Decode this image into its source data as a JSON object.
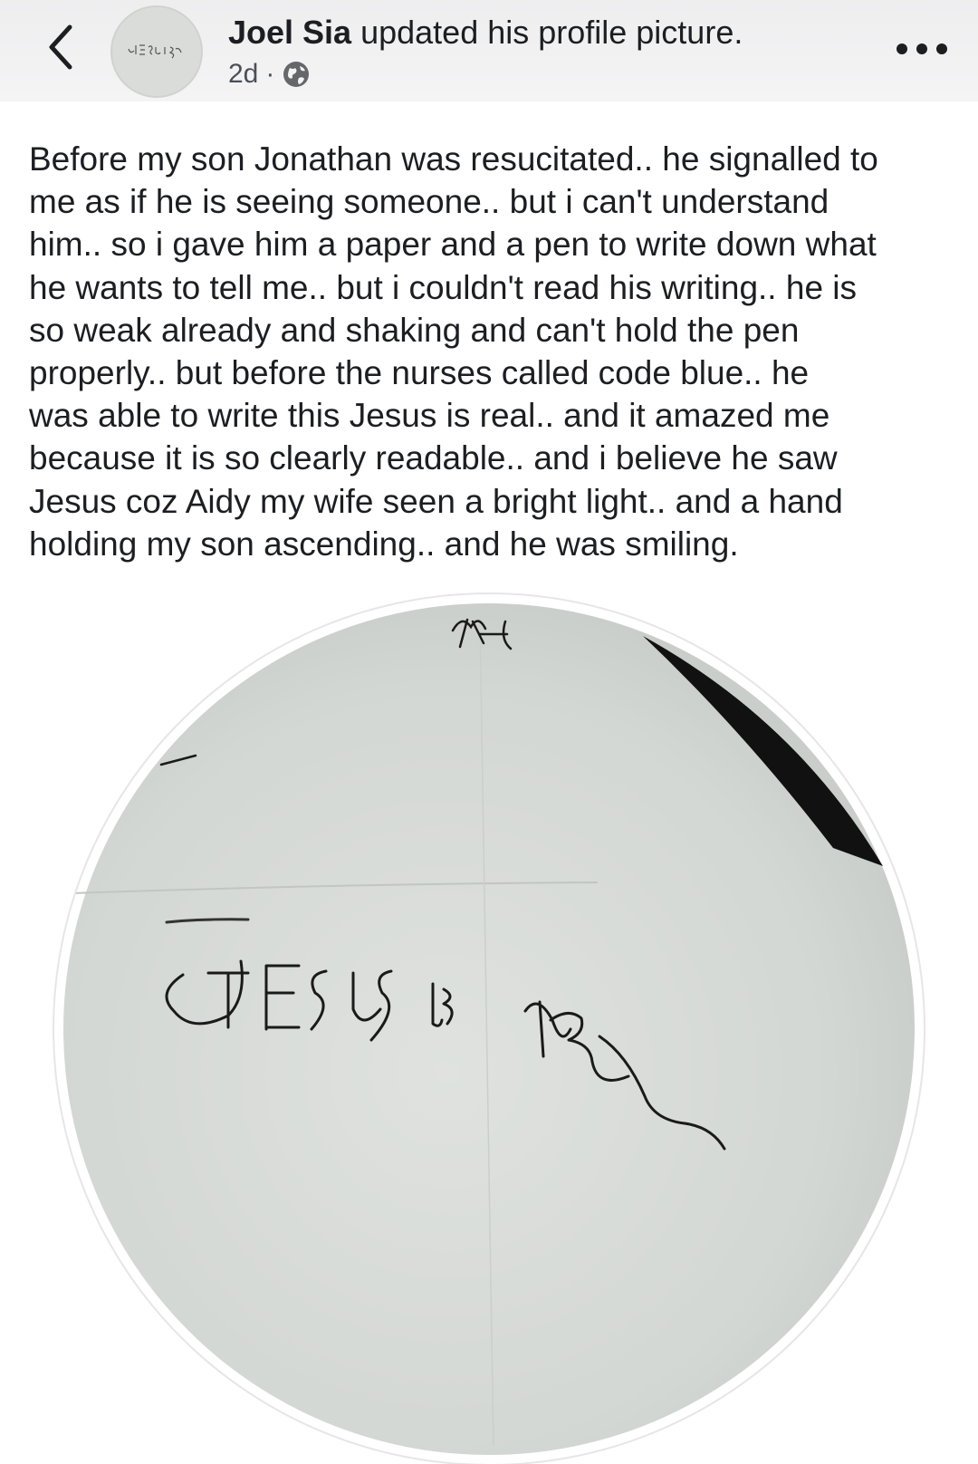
{
  "header": {
    "author_name": "Joel Sia",
    "action_text": " updated his profile picture.",
    "time": "2d",
    "separator": "·",
    "back_icon": "chevron-left-icon",
    "privacy_icon": "globe-icon",
    "more_icon": "more-horizontal-icon"
  },
  "post": {
    "lines": [
      "Before my son Jonathan was resucitated.. he signalled to",
      "me as if he is seeing someone.. but i can't understand",
      "him.. so i gave him a paper and a pen to write down what",
      "he wants to tell me.. but i couldn't read his writing.. he is",
      "so weak already and shaking and can't hold the pen",
      "properly.. but before the nurses called code blue.. he",
      "was able to write this Jesus is real.. and it amazed me",
      "because it is so clearly readable.. and i believe he saw",
      "Jesus coz Aidy my wife seen a bright light.. and a hand",
      "holding my son ascending.. and he was smiling."
    ]
  },
  "photo": {
    "handwriting": "JESUS IS REAL",
    "paper_color": "#d8dcd8",
    "ink_color": "#1a1a1a"
  }
}
